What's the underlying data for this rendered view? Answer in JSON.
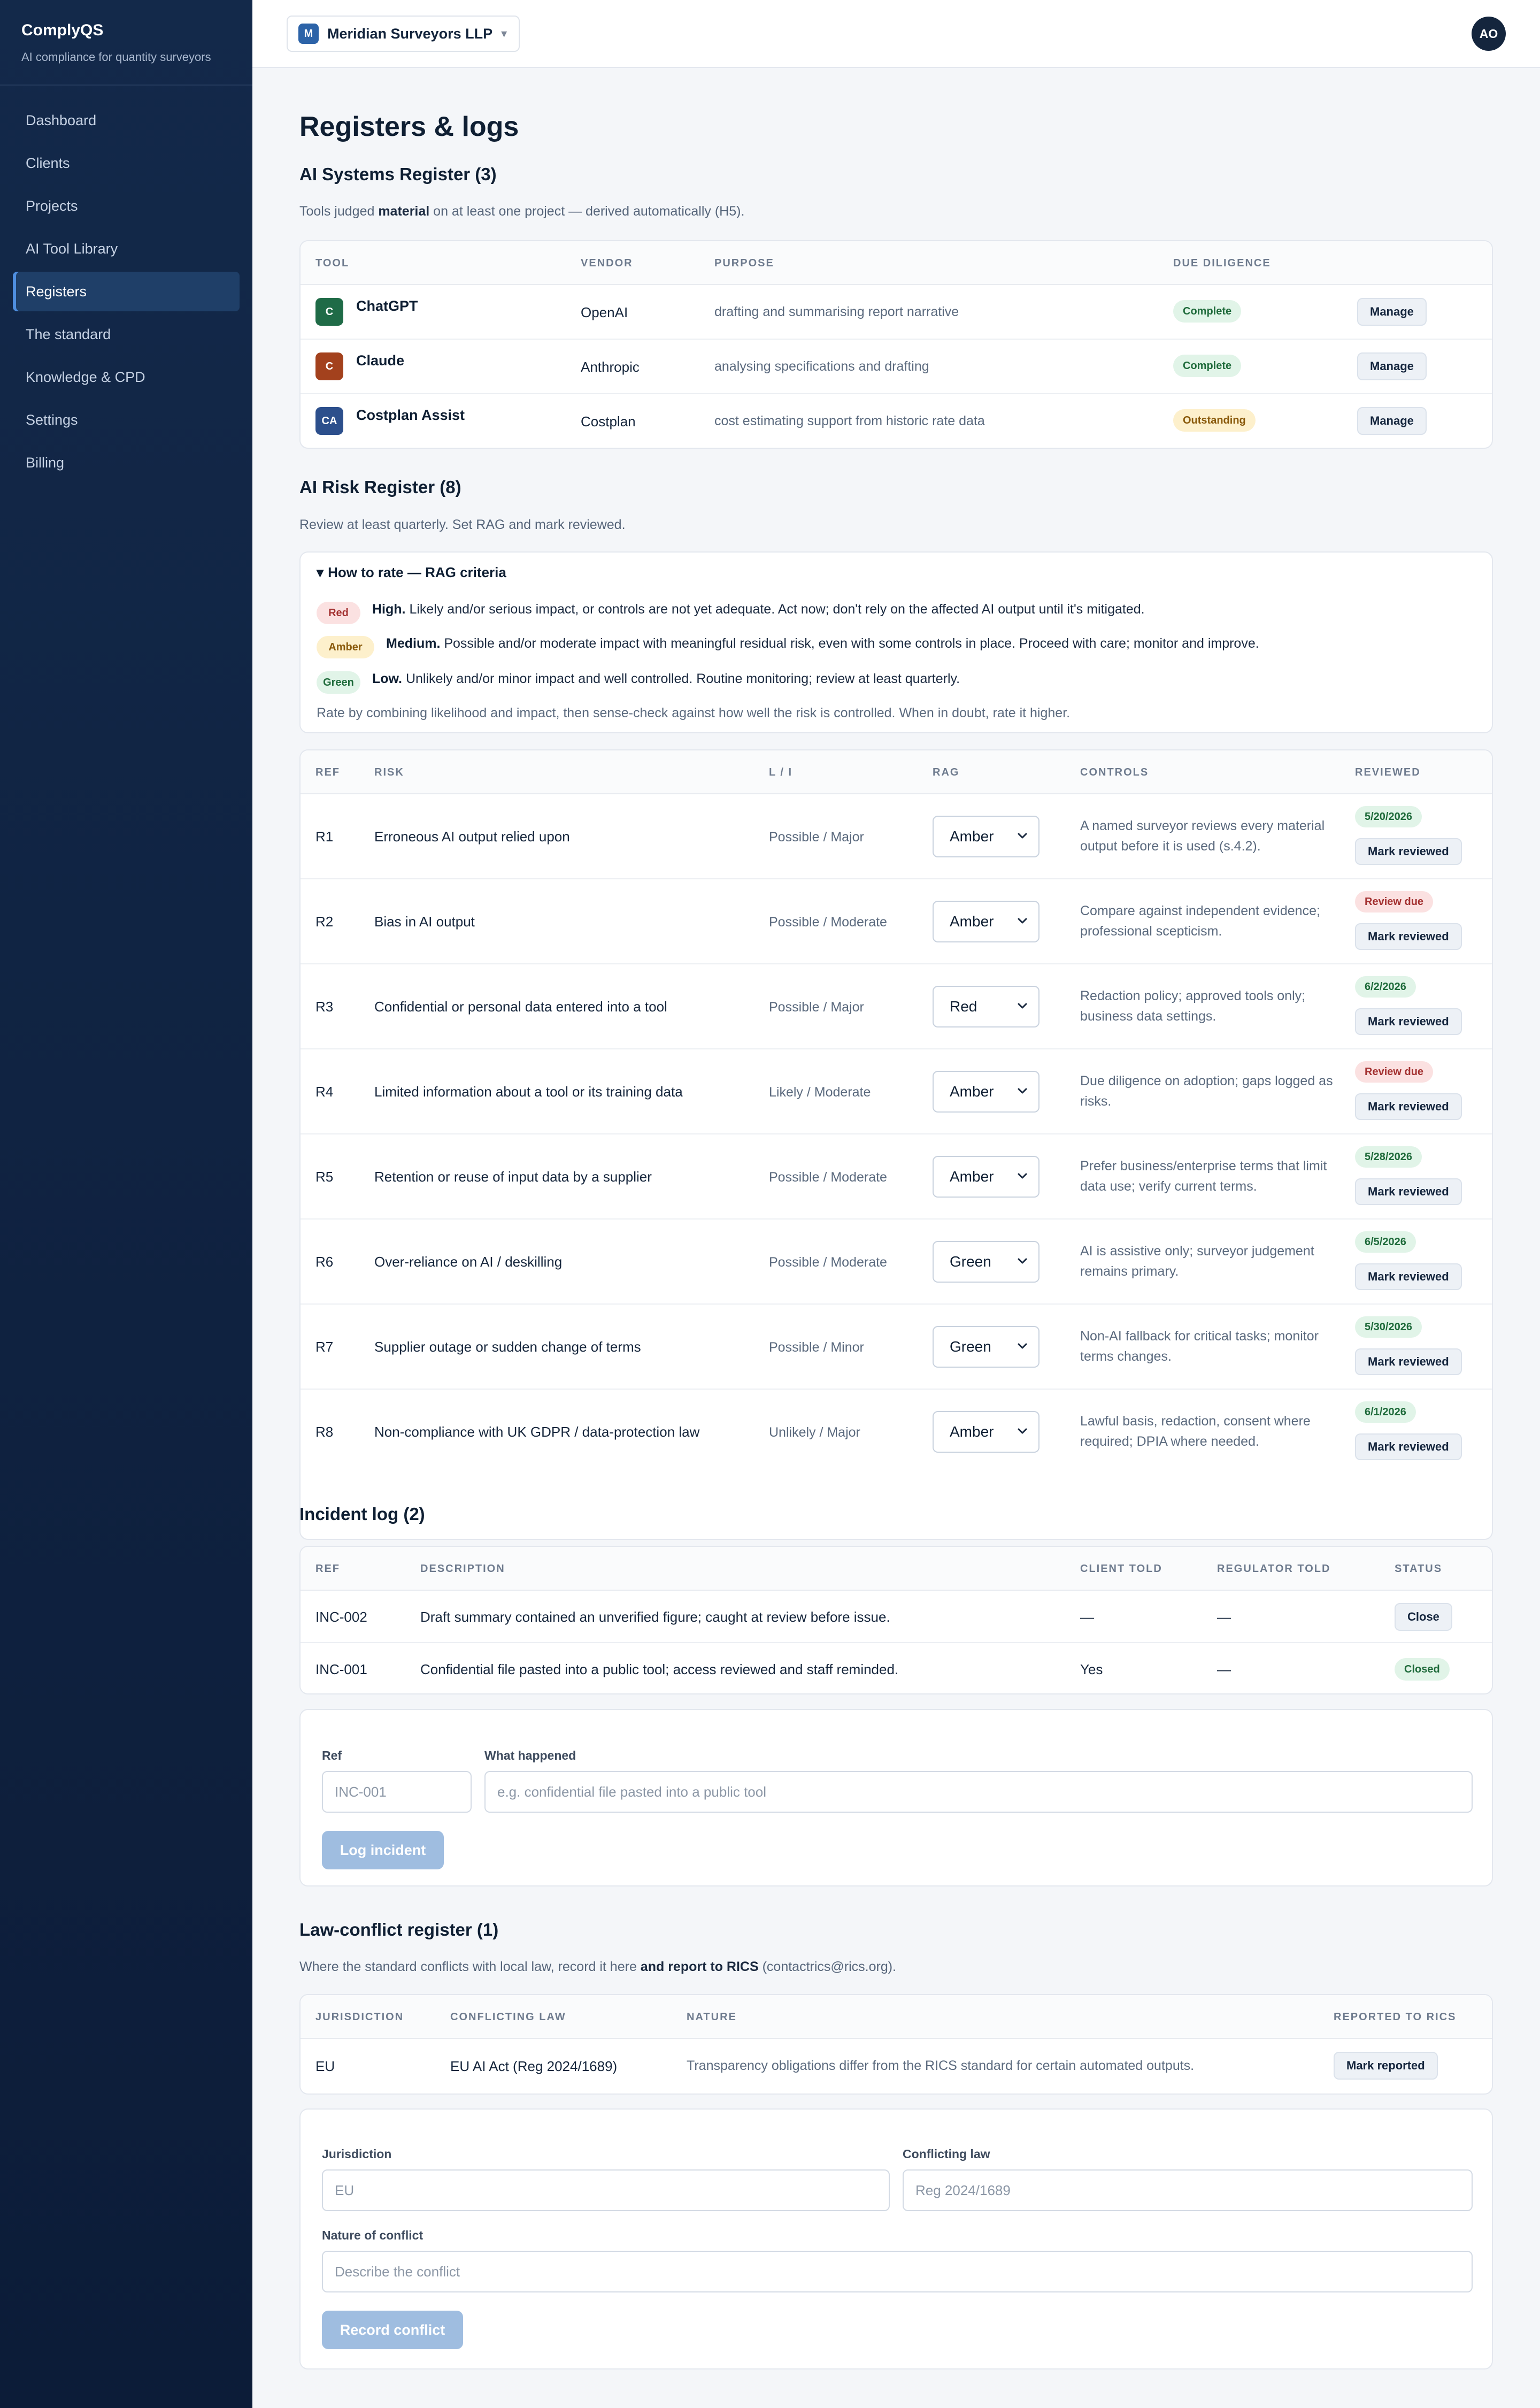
{
  "brand": {
    "name": "ComplyQS",
    "tagline": "AI compliance for quantity surveyors"
  },
  "nav": [
    {
      "label": "Dashboard",
      "active": false
    },
    {
      "label": "Clients",
      "active": false
    },
    {
      "label": "Projects",
      "active": false
    },
    {
      "label": "AI Tool Library",
      "active": false
    },
    {
      "label": "Registers",
      "active": true
    },
    {
      "label": "The standard",
      "active": false
    },
    {
      "label": "Knowledge & CPD",
      "active": false
    },
    {
      "label": "Settings",
      "active": false
    },
    {
      "label": "Billing",
      "active": false
    }
  ],
  "topbar": {
    "org_initial": "M",
    "org_name": "Meridian Surveyors LLP",
    "org_caret": "▾",
    "avatar": "AO"
  },
  "page": {
    "title": "Registers & logs"
  },
  "ai_systems": {
    "heading": "AI Systems Register (3)",
    "intro_before": "Tools judged ",
    "intro_bold": "material",
    "intro_after": " on at least one project — derived automatically (H5).",
    "columns": [
      "TOOL",
      "VENDOR",
      "PURPOSE",
      "DUE DILIGENCE"
    ],
    "rows": [
      {
        "icon": "C",
        "icon_color": "#1f6b47",
        "tool": "ChatGPT",
        "vendor": "OpenAI",
        "purpose": "drafting and summarising report narrative",
        "status": "Complete",
        "status_kind": "green",
        "action": "Manage"
      },
      {
        "icon": "C",
        "icon_color": "#a3411d",
        "tool": "Claude",
        "vendor": "Anthropic",
        "purpose": "analysing specifications and drafting",
        "status": "Complete",
        "status_kind": "green",
        "action": "Manage"
      },
      {
        "icon": "CA",
        "icon_color": "#2c4f8c",
        "tool": "Costplan Assist",
        "vendor": "Costplan",
        "purpose": "cost estimating support from historic rate data",
        "status": "Outstanding",
        "status_kind": "amber",
        "action": "Manage"
      }
    ]
  },
  "ai_risk": {
    "heading": "AI Risk Register (8)",
    "intro": "Review at least quarterly. Set RAG and mark reviewed.",
    "criteria": {
      "title": "How to rate — RAG criteria",
      "marker": "▾",
      "items": [
        {
          "badge": "Red",
          "kind": "red",
          "strong": "High.",
          "text": " Likely and/or serious impact, or controls are not yet adequate. Act now; don't rely on the affected AI output until it's mitigated."
        },
        {
          "badge": "Amber",
          "kind": "amber",
          "strong": "Medium.",
          "text": " Possible and/or moderate impact with meaningful residual risk, even with some controls in place. Proceed with care; monitor and improve."
        },
        {
          "badge": "Green",
          "kind": "green",
          "strong": "Low.",
          "text": " Unlikely and/or minor impact and well controlled. Routine monitoring; review at least quarterly."
        }
      ],
      "footer": "Rate by combining likelihood and impact, then sense-check against how well the risk is controlled. When in doubt, rate it higher."
    },
    "columns": [
      "REF",
      "RISK",
      "L / I",
      "RAG",
      "CONTROLS",
      "REVIEWED"
    ],
    "rows": [
      {
        "ref": "R1",
        "risk": "Erroneous AI output relied upon",
        "li": "Possible / Major",
        "rag": "Amber",
        "controls": "A named surveyor reviews every material output before it is used (s.4.2).",
        "reviewed": "5/20/2026",
        "reviewed_kind": "green",
        "action": "Mark reviewed"
      },
      {
        "ref": "R2",
        "risk": "Bias in AI output",
        "li": "Possible / Moderate",
        "rag": "Amber",
        "controls": "Compare against independent evidence; professional scepticism.",
        "reviewed": "Review due",
        "reviewed_kind": "red",
        "action": "Mark reviewed"
      },
      {
        "ref": "R3",
        "risk": "Confidential or personal data entered into a tool",
        "li": "Possible / Major",
        "rag": "Red",
        "controls": "Redaction policy; approved tools only; business data settings.",
        "reviewed": "6/2/2026",
        "reviewed_kind": "green",
        "action": "Mark reviewed"
      },
      {
        "ref": "R4",
        "risk": "Limited information about a tool or its training data",
        "li": "Likely / Moderate",
        "rag": "Amber",
        "controls": "Due diligence on adoption; gaps logged as risks.",
        "reviewed": "Review due",
        "reviewed_kind": "red",
        "action": "Mark reviewed"
      },
      {
        "ref": "R5",
        "risk": "Retention or reuse of input data by a supplier",
        "li": "Possible / Moderate",
        "rag": "Amber",
        "controls": "Prefer business/enterprise terms that limit data use; verify current terms.",
        "reviewed": "5/28/2026",
        "reviewed_kind": "green",
        "action": "Mark reviewed"
      },
      {
        "ref": "R6",
        "risk": "Over-reliance on AI / deskilling",
        "li": "Possible / Moderate",
        "rag": "Green",
        "controls": "AI is assistive only; surveyor judgement remains primary.",
        "reviewed": "6/5/2026",
        "reviewed_kind": "green",
        "action": "Mark reviewed"
      },
      {
        "ref": "R7",
        "risk": "Supplier outage or sudden change of terms",
        "li": "Possible / Minor",
        "rag": "Green",
        "controls": "Non-AI fallback for critical tasks; monitor terms changes.",
        "reviewed": "5/30/2026",
        "reviewed_kind": "green",
        "action": "Mark reviewed"
      },
      {
        "ref": "R8",
        "risk": "Non-compliance with UK GDPR / data-protection law",
        "li": "Unlikely / Major",
        "rag": "Amber",
        "controls": "Lawful basis, redaction, consent where required; DPIA where needed.",
        "reviewed": "6/1/2026",
        "reviewed_kind": "green",
        "action": "Mark reviewed"
      }
    ]
  },
  "incidents": {
    "heading": "Incident log (2)",
    "columns": [
      "REF",
      "DESCRIPTION",
      "CLIENT TOLD",
      "REGULATOR TOLD",
      "STATUS"
    ],
    "rows": [
      {
        "ref": "INC-002",
        "description": "Draft summary contained an unverified figure; caught at review before issue.",
        "client": "—",
        "regulator": "—",
        "status": "Close",
        "status_kind": "button"
      },
      {
        "ref": "INC-001",
        "description": "Confidential file pasted into a public tool; access reviewed and staff reminded.",
        "client": "Yes",
        "regulator": "—",
        "status": "Closed",
        "status_kind": "green"
      }
    ],
    "form": {
      "ref_label": "Ref",
      "ref_placeholder": "INC-001",
      "what_label": "What happened",
      "what_placeholder": "e.g. confidential file pasted into a public tool",
      "submit": "Log incident"
    }
  },
  "law_conflict": {
    "heading": "Law-conflict register (1)",
    "intro_before": "Where the standard conflicts with local law, record it here ",
    "intro_bold": "and report to RICS",
    "intro_after": " (contactrics@rics.org).",
    "columns": [
      "JURISDICTION",
      "CONFLICTING LAW",
      "NATURE",
      "REPORTED TO RICS"
    ],
    "rows": [
      {
        "jurisdiction": "EU",
        "law": "EU AI Act (Reg 2024/1689)",
        "nature": "Transparency obligations differ from the RICS standard for certain automated outputs.",
        "action": "Mark reported"
      }
    ],
    "form": {
      "jurisdiction_label": "Jurisdiction",
      "jurisdiction_placeholder": "EU",
      "law_label": "Conflicting law",
      "law_placeholder": "Reg 2024/1689",
      "nature_label": "Nature of conflict",
      "nature_placeholder": "Describe the conflict",
      "submit": "Record conflict"
    }
  }
}
